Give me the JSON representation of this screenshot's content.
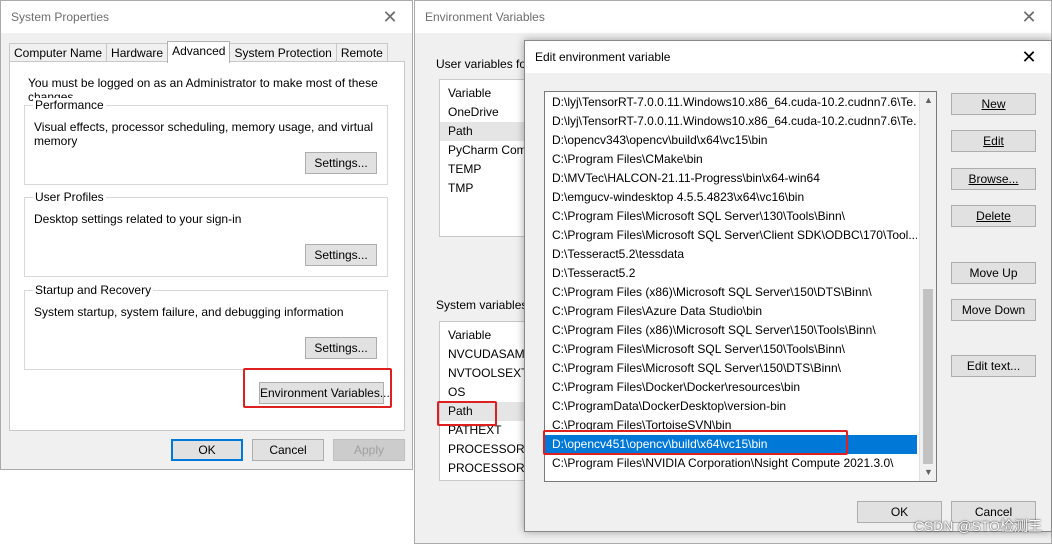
{
  "system_properties": {
    "title": "System Properties",
    "tabs": [
      "Computer Name",
      "Hardware",
      "Advanced",
      "System Protection",
      "Remote"
    ],
    "admin_note": "You must be logged on as an Administrator to make most of these changes.",
    "performance": {
      "legend": "Performance",
      "desc": "Visual effects, processor scheduling, memory usage, and virtual memory",
      "button": "Settings..."
    },
    "user_profiles": {
      "legend": "User Profiles",
      "desc": "Desktop settings related to your sign-in",
      "button": "Settings..."
    },
    "startup_recovery": {
      "legend": "Startup and Recovery",
      "desc": "System startup, system failure, and debugging information",
      "button": "Settings..."
    },
    "env_button": "Environment Variables...",
    "ok": "OK",
    "cancel": "Cancel",
    "apply": "Apply"
  },
  "environment_variables": {
    "title": "Environment Variables",
    "user_vars_label": "User variables for",
    "user_header": "Variable",
    "user_vars": [
      "OneDrive",
      "Path",
      "PyCharm Com",
      "TEMP",
      "TMP"
    ],
    "system_vars_label": "System variables",
    "system_header": "Variable",
    "system_vars": [
      "NVCUDASAMP",
      "NVTOOLSEXT_P",
      "OS",
      "Path",
      "PATHEXT",
      "PROCESSOR_A",
      "PROCESSOR_ID"
    ]
  },
  "edit_env_var": {
    "title": "Edit environment variable",
    "paths": [
      "D:\\lyj\\TensorRT-7.0.0.11.Windows10.x86_64.cuda-10.2.cudnn7.6\\Te...",
      "D:\\lyj\\TensorRT-7.0.0.11.Windows10.x86_64.cuda-10.2.cudnn7.6\\Te...",
      "D:\\opencv343\\opencv\\build\\x64\\vc15\\bin",
      "C:\\Program Files\\CMake\\bin",
      "D:\\MVTec\\HALCON-21.11-Progress\\bin\\x64-win64",
      "D:\\emgucv-windesktop 4.5.5.4823\\x64\\vc16\\bin",
      "C:\\Program Files\\Microsoft SQL Server\\130\\Tools\\Binn\\",
      "C:\\Program Files\\Microsoft SQL Server\\Client SDK\\ODBC\\170\\Tool...",
      "D:\\Tesseract5.2\\tessdata",
      "D:\\Tesseract5.2",
      "C:\\Program Files (x86)\\Microsoft SQL Server\\150\\DTS\\Binn\\",
      "C:\\Program Files\\Azure Data Studio\\bin",
      "C:\\Program Files (x86)\\Microsoft SQL Server\\150\\Tools\\Binn\\",
      "C:\\Program Files\\Microsoft SQL Server\\150\\Tools\\Binn\\",
      "C:\\Program Files\\Microsoft SQL Server\\150\\DTS\\Binn\\",
      "C:\\Program Files\\Docker\\Docker\\resources\\bin",
      "C:\\ProgramData\\DockerDesktop\\version-bin",
      "C:\\Program Files\\TortoiseSVN\\bin",
      "D:\\opencv451\\opencv\\build\\x64\\vc15\\bin",
      "C:\\Program Files\\NVIDIA Corporation\\Nsight Compute 2021.3.0\\"
    ],
    "selected_index": 18,
    "buttons": {
      "new": "New",
      "edit": "Edit",
      "browse": "Browse...",
      "delete": "Delete",
      "move_up": "Move Up",
      "move_down": "Move Down",
      "edit_text": "Edit text...",
      "ok": "OK",
      "cancel": "Cancel"
    }
  },
  "watermark": "CSDN @STO检测王",
  "colors": {
    "selection": "#0078d7",
    "highlight_box": "#e02020"
  }
}
